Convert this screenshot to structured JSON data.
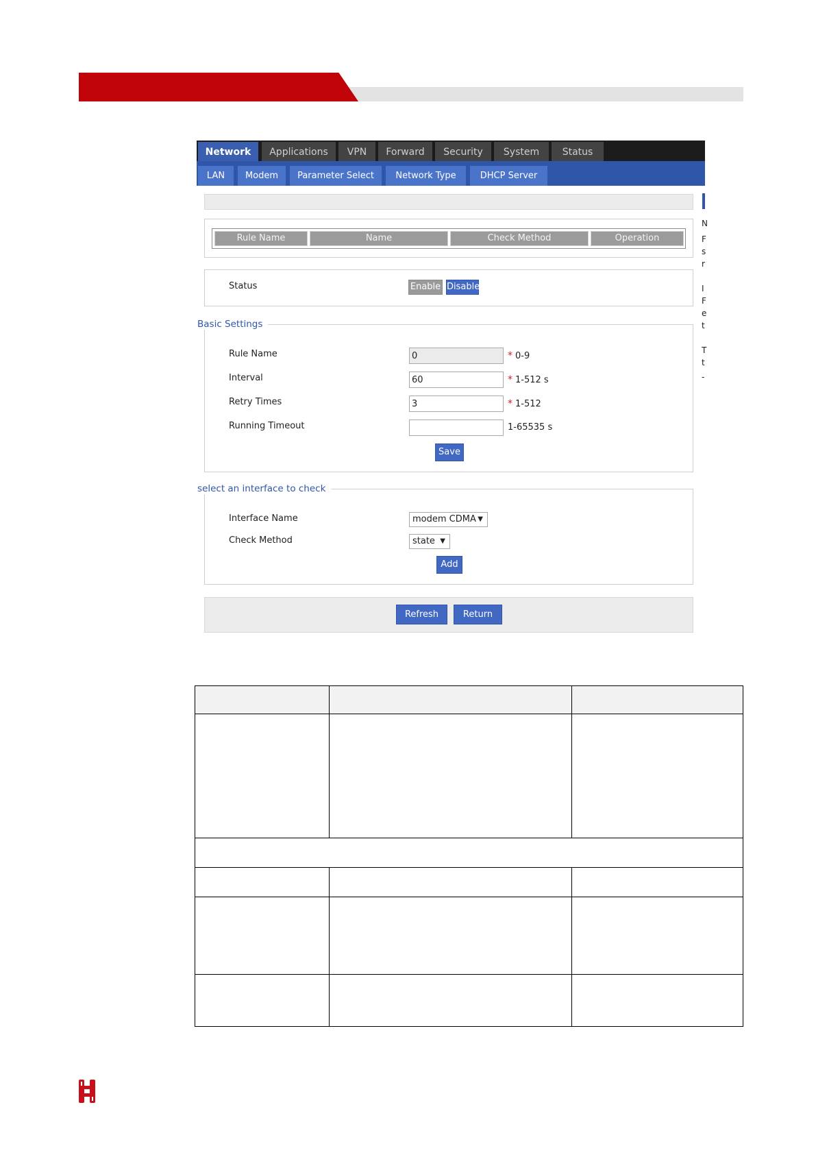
{
  "banner": {
    "accent_color": "#bf0308",
    "bar_color": "#e3e3e3"
  },
  "top_nav": {
    "tabs": [
      {
        "label": "Network",
        "active": true
      },
      {
        "label": "Applications"
      },
      {
        "label": "VPN"
      },
      {
        "label": "Forward"
      },
      {
        "label": "Security"
      },
      {
        "label": "System"
      },
      {
        "label": "Status"
      }
    ]
  },
  "sub_nav": {
    "tabs": [
      {
        "label": "LAN"
      },
      {
        "label": "Modem"
      },
      {
        "label": "Parameter Select"
      },
      {
        "label": "Network Type"
      },
      {
        "label": "DHCP Server"
      }
    ]
  },
  "rules_table": {
    "headers": [
      "Rule Name",
      "Name",
      "Check Method",
      "Operation"
    ]
  },
  "status_panel": {
    "label": "Status",
    "enable_label": "Enable",
    "disable_label": "Disable"
  },
  "basic_settings": {
    "title": "Basic Settings",
    "fields": [
      {
        "label": "Rule Name",
        "value": "0",
        "required": true,
        "hint": "0-9"
      },
      {
        "label": "Interval",
        "value": "60",
        "required": true,
        "hint": "1-512 s"
      },
      {
        "label": "Retry Times",
        "value": "3",
        "required": true,
        "hint": "1-512"
      },
      {
        "label": "Running Timeout",
        "value": "",
        "required": false,
        "hint": "1-65535 s"
      }
    ],
    "save_label": "Save"
  },
  "interface_check": {
    "title": "select an interface to check",
    "interface_label": "Interface Name",
    "interface_value": "modem CDMA",
    "method_label": "Check Method",
    "method_value": "state",
    "add_label": "Add"
  },
  "footer_buttons": {
    "refresh_label": "Refresh",
    "return_label": "Return"
  },
  "cut_off_side_text": [
    "N",
    "F",
    "s",
    "r",
    "I",
    "F",
    "e",
    "t",
    "T",
    "t",
    "-"
  ],
  "colors": {
    "primary_blue": "#2f56a8",
    "button_blue": "#4169c4",
    "required_red": "#d21b1b"
  },
  "icons": {
    "logo": "red-brand-logo-icon"
  }
}
